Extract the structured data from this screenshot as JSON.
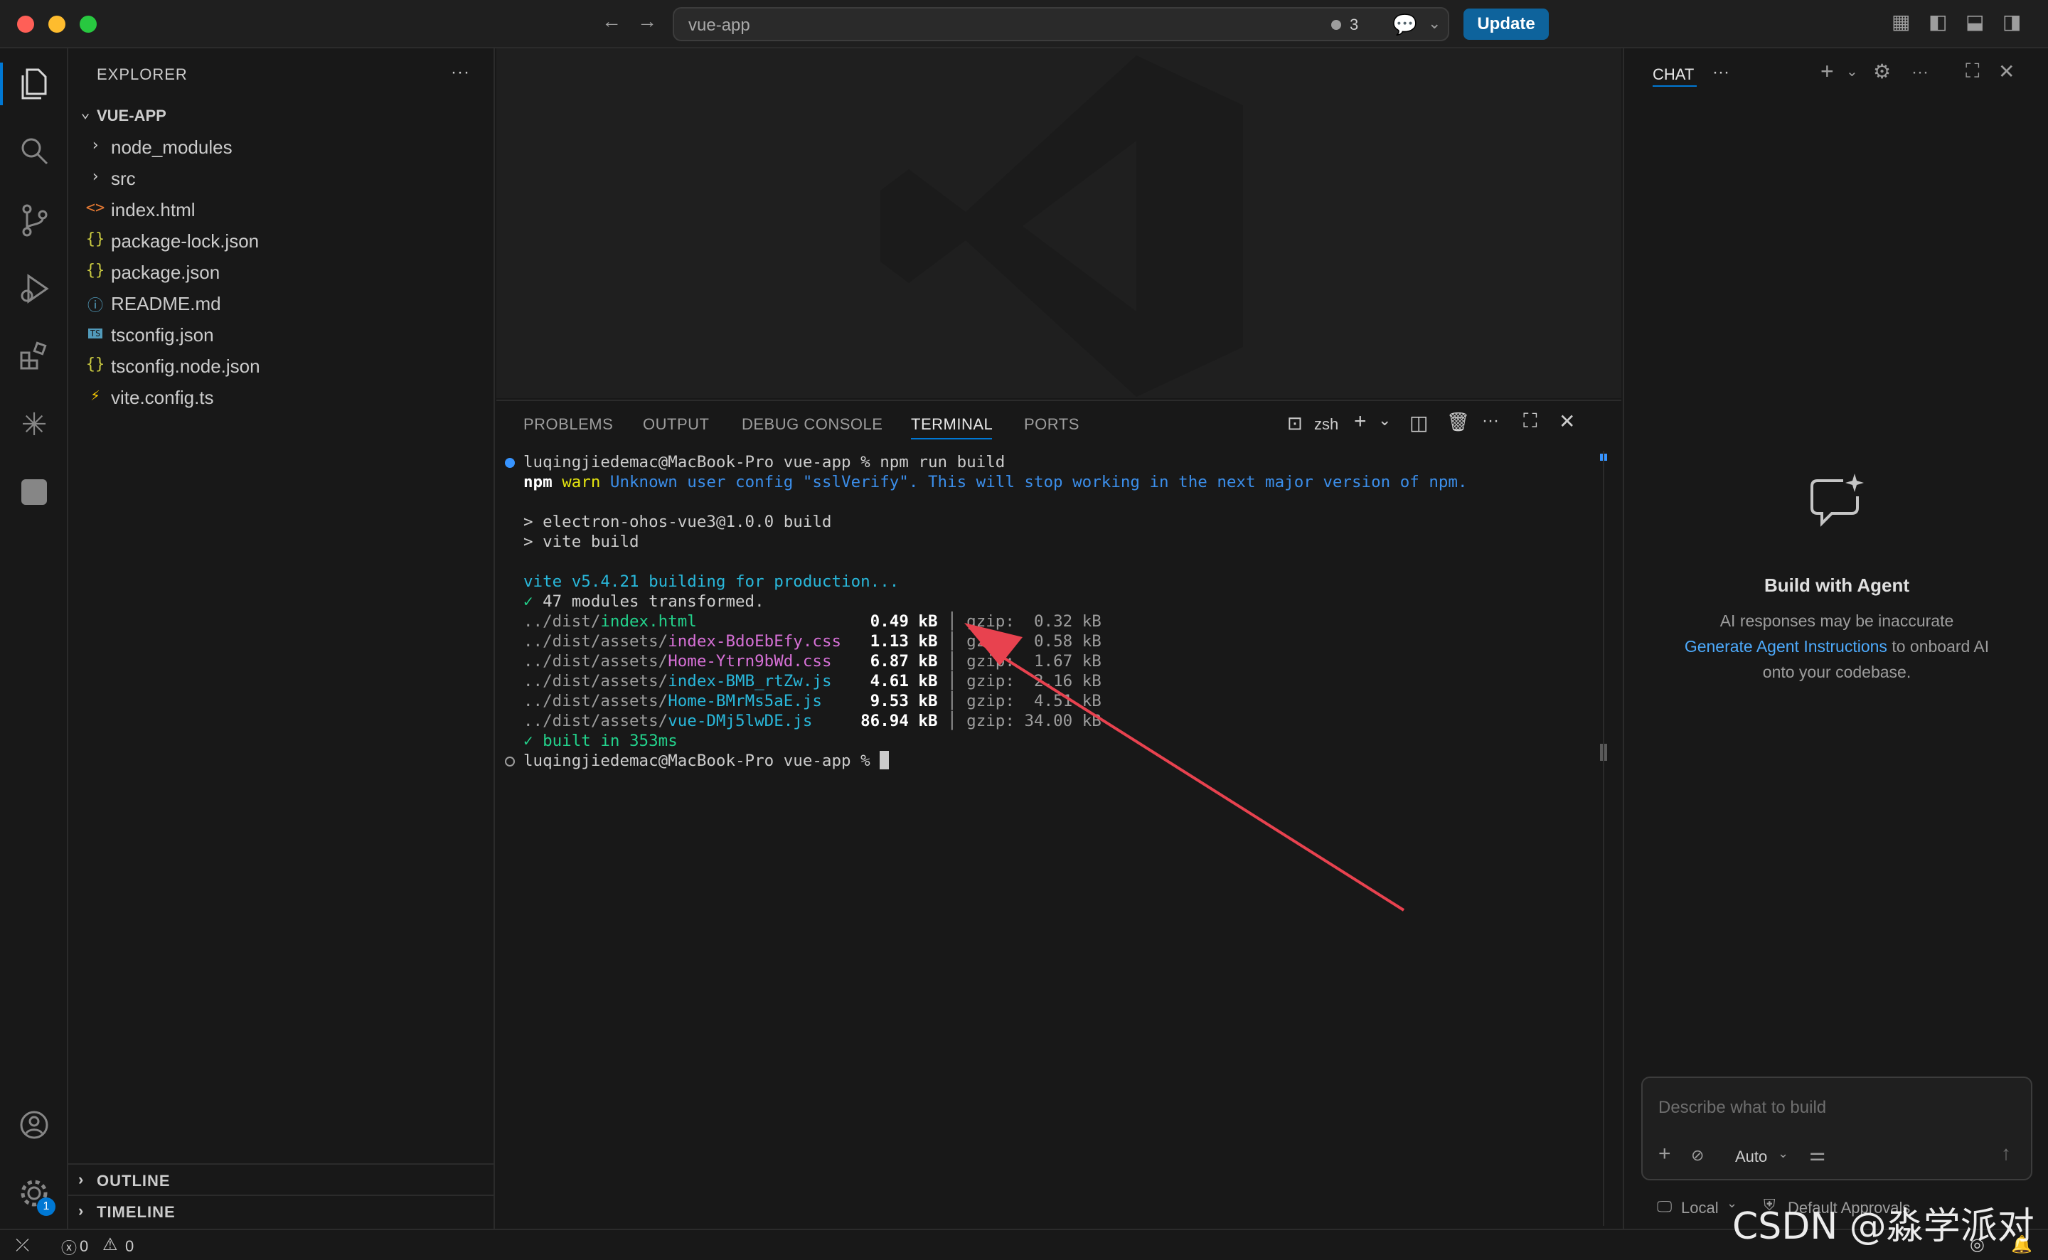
{
  "titlebar": {
    "search_label": "vue-app",
    "changes_count": "3",
    "update_label": "Update"
  },
  "sidebar": {
    "title": "EXPLORER",
    "more": "···",
    "root": "VUE-APP",
    "files": [
      {
        "name": "node_modules",
        "icon": "›",
        "icon_color": "#cccccc"
      },
      {
        "name": "src",
        "icon": "›",
        "icon_color": "#cccccc"
      },
      {
        "name": "index.html",
        "icon": "<>",
        "icon_color": "#e37933"
      },
      {
        "name": "package-lock.json",
        "icon": "{}",
        "icon_color": "#cbcb41"
      },
      {
        "name": "package.json",
        "icon": "{}",
        "icon_color": "#cbcb41"
      },
      {
        "name": "README.md",
        "icon": "ⓘ",
        "icon_color": "#519aba"
      },
      {
        "name": "tsconfig.json",
        "icon": "TS",
        "icon_color": "#519aba"
      },
      {
        "name": "tsconfig.node.json",
        "icon": "{}",
        "icon_color": "#cbcb41"
      },
      {
        "name": "vite.config.ts",
        "icon": "⚡",
        "icon_color": "#ffcf00"
      }
    ],
    "outline": "OUTLINE",
    "timeline": "TIMELINE"
  },
  "panel": {
    "tabs": [
      "PROBLEMS",
      "OUTPUT",
      "DEBUG CONSOLE",
      "TERMINAL",
      "PORTS"
    ],
    "active_tab": "TERMINAL",
    "shell": "zsh"
  },
  "terminal": {
    "prompt1": "luqingjiedemac@MacBook-Pro vue-app % npm run build",
    "warn_npm": "npm",
    "warn_word": "warn",
    "warn_msg": "Unknown user config \"sslVerify\". This will stop working in the next major version of npm.",
    "script1": "> electron-ohos-vue3@1.0.0 build",
    "script2": "> vite build",
    "vite_line": "vite v5.4.21 building for production...",
    "modules": "✓ 47 modules transformed.",
    "outputs": [
      {
        "dir": "../dist/",
        "file": "index.html",
        "cls": "g",
        "size": "0.49 kB",
        "gzip": "0.32 kB"
      },
      {
        "dir": "../dist/assets/",
        "file": "index-BdoEbEfy.css",
        "cls": "m",
        "size": "1.13 kB",
        "gzip": "0.58 kB"
      },
      {
        "dir": "../dist/assets/",
        "file": "Home-Ytrn9bWd.css",
        "cls": "m",
        "size": "6.87 kB",
        "gzip": "1.67 kB"
      },
      {
        "dir": "../dist/assets/",
        "file": "index-BMB_rtZw.js",
        "cls": "c",
        "size": "4.61 kB",
        "gzip": "2.16 kB"
      },
      {
        "dir": "../dist/assets/",
        "file": "Home-BMrMs5aE.js",
        "cls": "c",
        "size": "9.53 kB",
        "gzip": "4.51 kB"
      },
      {
        "dir": "../dist/assets/",
        "file": "vue-DMj5lwDE.js",
        "cls": "c",
        "size": "86.94 kB",
        "gzip": "34.00 kB"
      }
    ],
    "built": "✓ built in 353ms",
    "prompt2": "luqingjiedemac@MacBook-Pro vue-app % "
  },
  "chat": {
    "tab": "CHAT",
    "heading": "Build with Agent",
    "line1": "AI responses may be inaccurate",
    "link": "Generate Agent Instructions",
    "line2_rest": " to onboard AI",
    "line3": "onto your codebase.",
    "input_placeholder": "Describe what to build",
    "mode": "Auto",
    "location": "Local",
    "approvals": "Default Approvals"
  },
  "statusbar": {
    "errors": "0",
    "warnings": "0"
  },
  "watermark": "CSDN @淼学派对",
  "colors": {
    "accent": "#0e639c",
    "arrow": "#e8424f",
    "link": "#4daafc"
  }
}
